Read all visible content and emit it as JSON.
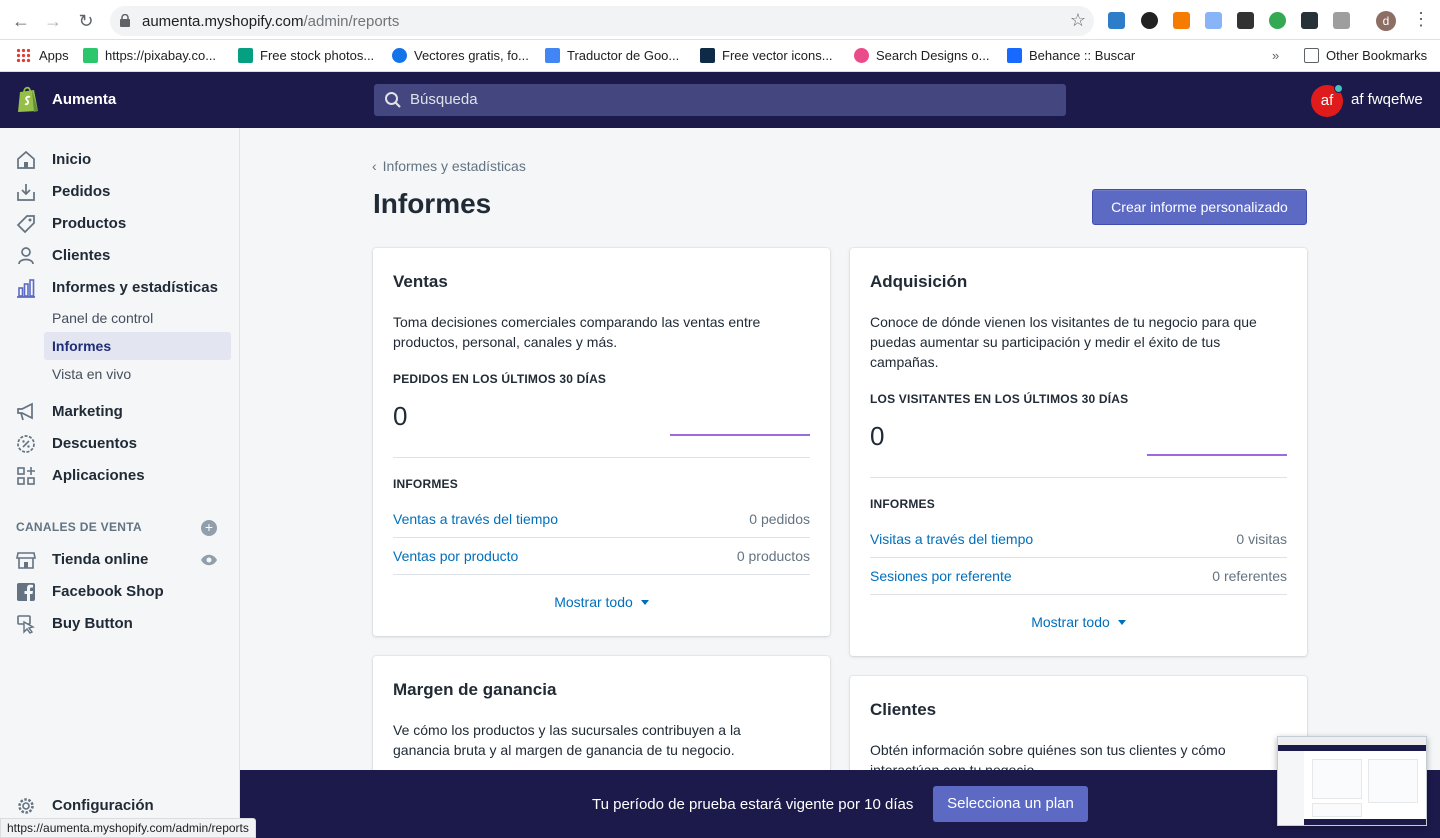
{
  "browser": {
    "url_host": "aumenta.myshopify.com",
    "url_path": "/admin/reports",
    "profile_initial": "d",
    "bookmarks": [
      {
        "label": "Apps",
        "icon": "apps-grid-icon",
        "color": "#e53935"
      },
      {
        "label": "https://pixabay.co...",
        "icon": "pixabay-icon",
        "color": "#2ec66d"
      },
      {
        "label": "Free stock photos...",
        "icon": "pexels-icon",
        "color": "#05a081"
      },
      {
        "label": "Vectores gratis, fo...",
        "icon": "freepik-icon",
        "color": "#1273eb"
      },
      {
        "label": "Traductor de Goo...",
        "icon": "google-translate-icon",
        "color": "#4285f4"
      },
      {
        "label": "Free vector icons...",
        "icon": "flaticon-icon",
        "color": "#0e2a47"
      },
      {
        "label": "Search Designs o...",
        "icon": "dribbble-icon",
        "color": "#ea4c89"
      },
      {
        "label": "Behance :: Buscar",
        "icon": "behance-icon",
        "color": "#1769ff"
      }
    ],
    "other_bookmarks": "Other Bookmarks",
    "status_url": "https://aumenta.myshopify.com/admin/reports"
  },
  "topbar": {
    "store_name": "Aumenta",
    "search_placeholder": "Búsqueda",
    "avatar_initials": "af",
    "user_name": "af fwqefwe"
  },
  "sidebar": {
    "items": [
      {
        "label": "Inicio",
        "icon": "home-icon"
      },
      {
        "label": "Pedidos",
        "icon": "orders-icon"
      },
      {
        "label": "Productos",
        "icon": "tag-icon"
      },
      {
        "label": "Clientes",
        "icon": "person-icon"
      },
      {
        "label": "Informes y estadísticas",
        "icon": "bar-chart-icon"
      }
    ],
    "sub_items": [
      {
        "label": "Panel de control"
      },
      {
        "label": "Informes",
        "active": true
      },
      {
        "label": "Vista en vivo"
      }
    ],
    "items2": [
      {
        "label": "Marketing",
        "icon": "megaphone-icon"
      },
      {
        "label": "Descuentos",
        "icon": "discount-icon"
      },
      {
        "label": "Aplicaciones",
        "icon": "apps-icon"
      }
    ],
    "channels_title": "CANALES DE VENTA",
    "channels": [
      {
        "label": "Tienda online",
        "icon": "store-icon"
      },
      {
        "label": "Facebook Shop",
        "icon": "facebook-icon"
      },
      {
        "label": "Buy Button",
        "icon": "buy-button-icon"
      }
    ],
    "settings_label": "Configuración"
  },
  "main": {
    "breadcrumb": "Informes y estadísticas",
    "title": "Informes",
    "create_button": "Crear informe personalizado",
    "cards": {
      "ventas": {
        "title": "Ventas",
        "desc": "Toma decisiones comerciales comparando las ventas entre productos, personal, canales y más.",
        "metric_label": "PEDIDOS EN LOS ÚLTIMOS 30 DÍAS",
        "metric_value": "0",
        "reports_label": "INFORMES",
        "rows": [
          {
            "link": "Ventas a través del tiempo",
            "value": "0 pedidos"
          },
          {
            "link": "Ventas por producto",
            "value": "0 productos"
          }
        ],
        "show_all": "Mostrar todo"
      },
      "adquisicion": {
        "title": "Adquisición",
        "desc": "Conoce de dónde vienen los visitantes de tu negocio para que puedas aumentar su participación y medir el éxito de tus campañas.",
        "metric_label": "LOS VISITANTES EN LOS ÚLTIMOS 30 DÍAS",
        "metric_value": "0",
        "reports_label": "INFORMES",
        "rows": [
          {
            "link": "Visitas a través del tiempo",
            "value": "0 visitas"
          },
          {
            "link": "Sesiones por referente",
            "value": "0 referentes"
          }
        ],
        "show_all": "Mostrar todo"
      },
      "margen": {
        "title": "Margen de ganancia",
        "desc": "Ve cómo los productos y las sucursales contribuyen a la ganancia bruta y al margen de ganancia de tu negocio."
      },
      "clientes": {
        "title": "Clientes",
        "desc": "Obtén información sobre quiénes son tus clientes y cómo interactúan con tu negocio."
      }
    }
  },
  "trial": {
    "text": "Tu período de prueba estará vigente por 10 días",
    "button": "Selecciona un plan"
  },
  "colors": {
    "topbar": "#1c1a4b",
    "primary": "#5c6ac4",
    "link": "#006fbb",
    "sparkline": "#9c6ade"
  }
}
